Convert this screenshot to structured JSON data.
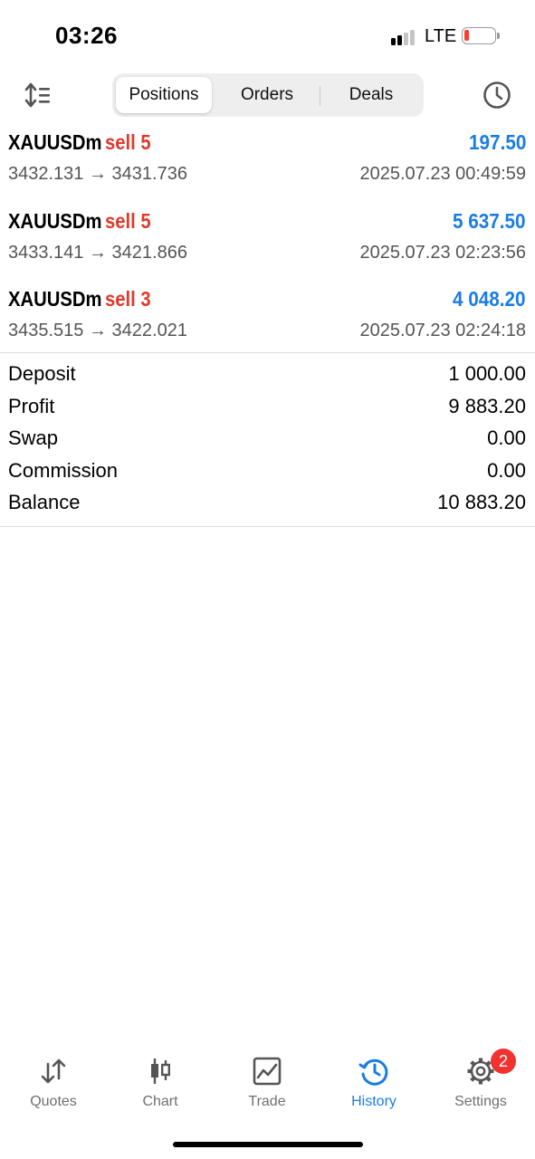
{
  "status_bar": {
    "time": "03:26",
    "network": "LTE",
    "signal_bars_active": 2,
    "battery_level": 0.1,
    "battery_color": "#ff3b30"
  },
  "toolbar": {
    "sort_icon": "sort-arrows-icon",
    "tabs": [
      {
        "label": "Positions",
        "active": true
      },
      {
        "label": "Orders",
        "active": false
      },
      {
        "label": "Deals",
        "active": false
      }
    ],
    "history_icon": "clock-icon"
  },
  "positions": [
    {
      "symbol": "XAUUSDm",
      "side": "sell 5",
      "profit": "197.50",
      "prices": "3432.131 → 3431.736",
      "time": "2025.07.23 00:49:59"
    },
    {
      "symbol": "XAUUSDm",
      "side": "sell 5",
      "profit": "5 637.50",
      "prices": "3433.141 → 3421.866",
      "time": "2025.07.23 02:23:56"
    },
    {
      "symbol": "XAUUSDm",
      "side": "sell 3",
      "profit": "4 048.20",
      "prices": "3435.515 → 3422.021",
      "time": "2025.07.23 02:24:18"
    }
  ],
  "summary": [
    {
      "label": "Deposit",
      "value": "1 000.00"
    },
    {
      "label": "Profit",
      "value": "9 883.20"
    },
    {
      "label": "Swap",
      "value": "0.00"
    },
    {
      "label": "Commission",
      "value": "0.00"
    },
    {
      "label": "Balance",
      "value": "10 883.20"
    }
  ],
  "tabbar": {
    "items": [
      {
        "label": "Quotes",
        "icon": "quotes-arrows-icon",
        "active": false
      },
      {
        "label": "Chart",
        "icon": "candlestick-chart-icon",
        "active": false
      },
      {
        "label": "Trade",
        "icon": "trade-line-chart-icon",
        "active": false
      },
      {
        "label": "History",
        "icon": "history-clock-icon",
        "active": true
      },
      {
        "label": "Settings",
        "icon": "gear-icon",
        "active": false
      }
    ],
    "settings_badge": "2"
  },
  "colors": {
    "accent": "#1a7de6",
    "sell": "#e0392b",
    "badge": "#f2322f"
  }
}
